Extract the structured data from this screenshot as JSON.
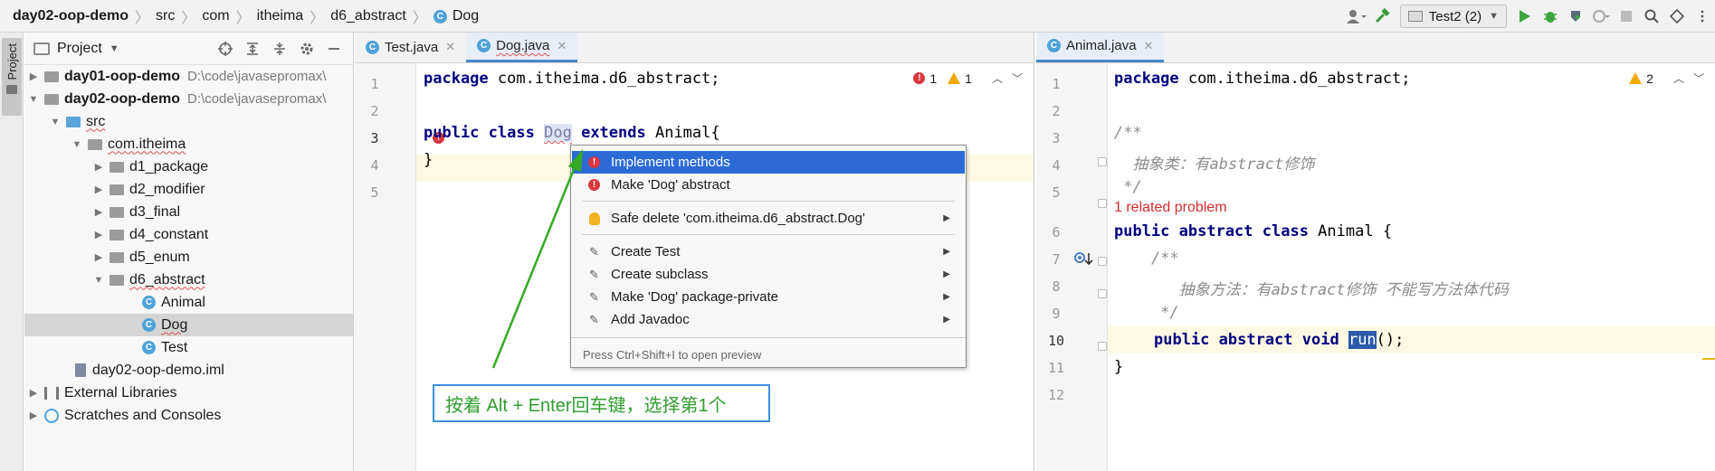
{
  "breadcrumb": [
    "day02-oop-demo",
    "src",
    "com",
    "itheima",
    "d6_abstract",
    "Dog"
  ],
  "toolbar": {
    "run_config": "Test2 (2)"
  },
  "left_strip": {
    "label": "Project"
  },
  "project": {
    "title": "Project",
    "tree": [
      {
        "label": "day01-oop-demo",
        "path": "D:\\code\\javasepromax\\"
      },
      {
        "label": "day02-oop-demo",
        "path": "D:\\code\\javasepromax\\"
      },
      {
        "label": "src"
      },
      {
        "label": "com.itheima"
      },
      {
        "label": "d1_package"
      },
      {
        "label": "d2_modifier"
      },
      {
        "label": "d3_final"
      },
      {
        "label": "d4_constant"
      },
      {
        "label": "d5_enum"
      },
      {
        "label": "d6_abstract"
      },
      {
        "label": "Animal"
      },
      {
        "label": "Dog"
      },
      {
        "label": "Test"
      },
      {
        "label": "day02-oop-demo.iml"
      },
      {
        "label": "External Libraries"
      },
      {
        "label": "Scratches and Consoles"
      }
    ]
  },
  "editor1": {
    "tabs": [
      "Test.java",
      "Dog.java"
    ],
    "active_tab": "Dog.java",
    "errors": "1",
    "warnings": "1",
    "line_numbers": [
      "1",
      "2",
      "3",
      "4",
      "5"
    ],
    "code": {
      "l1_kw": "package",
      "l1_rest": " com.itheima.d6_abstract;",
      "l3_kw1": "public",
      "l3_kw2": "class",
      "l3_ident": "Dog",
      "l3_kw3": "extends",
      "l3_rest": " Animal{",
      "l4": "}"
    }
  },
  "popup": {
    "items": [
      {
        "label": "Implement methods"
      },
      {
        "label": "Make 'Dog' abstract"
      },
      {
        "label": "Safe delete 'com.itheima.d6_abstract.Dog'"
      },
      {
        "label": "Create Test"
      },
      {
        "label": "Create subclass"
      },
      {
        "label": "Make 'Dog' package-private"
      },
      {
        "label": "Add Javadoc"
      }
    ],
    "footer": "Press Ctrl+Shift+I to open preview"
  },
  "annotation": {
    "text": "按着 Alt + Enter回车键，选择第1个"
  },
  "editor2": {
    "tab": "Animal.java",
    "warnings": "2",
    "line_numbers": [
      "1",
      "2",
      "3",
      "4",
      "5",
      "6",
      "7",
      "8",
      "9",
      "10",
      "11",
      "12"
    ],
    "related_problem": "1 related problem",
    "code": {
      "l1_kw": "package",
      "l1_rest": " com.itheima.d6_abstract;",
      "l3": "/**",
      "l4": "  抽象类：有abstract修饰",
      "l5": " */",
      "l6_kw": "public abstract class",
      "l6_rest": " Animal {",
      "l7": "    /**",
      "l8": "       抽象方法：有abstract修饰 不能写方法体代码",
      "l9": "     */",
      "l10_kw": "public abstract void",
      "l10_run": "run",
      "l10_rest": "();",
      "l11": "}"
    }
  },
  "colors": {
    "keyword": "#000080",
    "selection": "#2c6bd6",
    "annotation_text": "#2f9e2f",
    "annotation_border": "#3d8fe0",
    "error": "#d9363e",
    "arrow": "#33aa22"
  }
}
